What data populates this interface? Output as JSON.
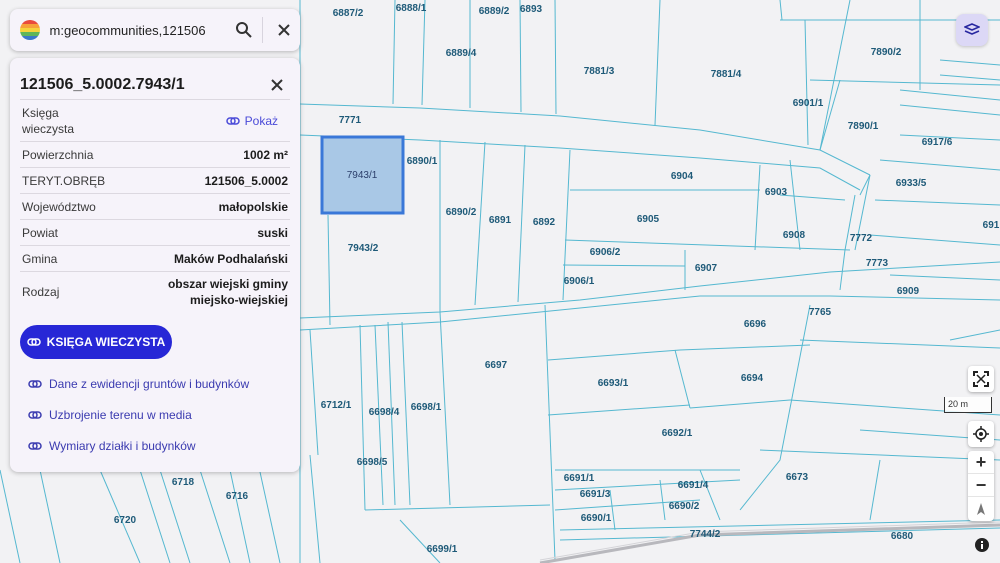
{
  "search": {
    "value": "m:geocommunities,121506",
    "search_icon": "search-icon",
    "clear_icon": "close-icon"
  },
  "panel": {
    "title": "121506_5.0002.7943/1",
    "rows": {
      "ksiega_label": "Księga wieczysta",
      "pokaz": "Pokaż",
      "powierzchnia_label": "Powierzchnia",
      "powierzchnia_value": "1002 m²",
      "teryt_label": "TERYT.OBRĘB",
      "teryt_value": "121506_5.0002",
      "wojewodztwo_label": "Województwo",
      "wojewodztwo_value": "małopolskie",
      "powiat_label": "Powiat",
      "powiat_value": "suski",
      "gmina_label": "Gmina",
      "gmina_value": "Maków Podhalański",
      "rodzaj_label": "Rodzaj",
      "rodzaj_value": "obszar wiejski gminy miejsko-wiejskiej"
    },
    "button": "KSIĘGA WIECZYSTA",
    "links": [
      "Dane z ewidencji gruntów i budynków",
      "Uzbrojenie terenu w media",
      "Wymiary działki i budynków"
    ]
  },
  "map": {
    "selected_parcel": "7943/1",
    "parcels": [
      "6887/2",
      "6888/1",
      "6889/2",
      "6893",
      "6889/4",
      "7881/3",
      "7881/4",
      "7890/2",
      "6901/1",
      "7890/1",
      "7771",
      "6890/1",
      "6917/6",
      "6904",
      "6903",
      "6933/5",
      "6890/2",
      "6891",
      "6892",
      "6905",
      "6908",
      "7772",
      "7943/2",
      "6906/2",
      "6907",
      "7773",
      "6906/1",
      "6909",
      "7765",
      "6696",
      "6697",
      "6693/1",
      "6694",
      "6712/1",
      "6698/4",
      "6698/1",
      "6692/1",
      "6698/5",
      "6673",
      "6691/1",
      "6691/4",
      "6718",
      "6716",
      "6691/3",
      "6690/2",
      "6720",
      "6690/1",
      "7744/2",
      "6680",
      "6699/1",
      "691"
    ],
    "scale": "20 m",
    "colors": {
      "parcel_line": "#55b8d0",
      "selected_fill": "#a9c8e6",
      "selected_stroke": "#3a78d8",
      "background": "#f2f2f4"
    }
  },
  "controls": {
    "layers_icon": "layers-icon",
    "fullscreen_icon": "fullscreen-icon",
    "locate_icon": "locate-icon",
    "zoom_in": "+",
    "zoom_out": "−",
    "compass_icon": "compass-icon",
    "info_icon": "info-icon"
  }
}
